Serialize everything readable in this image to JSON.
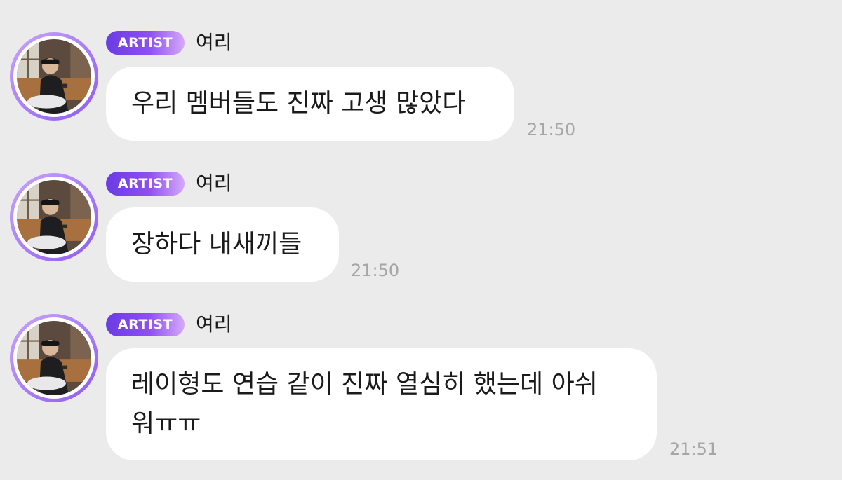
{
  "messages": [
    {
      "badge": "ARTIST",
      "sender": "여리",
      "text": "우리 멤버들도 진짜 고생 많았다",
      "time": "21:50"
    },
    {
      "badge": "ARTIST",
      "sender": "여리",
      "text": "장하다 내새끼들",
      "time": "21:50"
    },
    {
      "badge": "ARTIST",
      "sender": "여리",
      "text_line1": "레이형도 연습 같이 진짜 열심히 했는데 아쉬",
      "text_line2": "워ㅠㅠ",
      "time": "21:51"
    }
  ],
  "colors": {
    "background": "#ebebeb",
    "bubble": "#ffffff",
    "badge_start": "#6a3be4",
    "badge_end": "#d5a8fb",
    "avatar_ring": "#a478f5",
    "timestamp": "#a6a6a6"
  }
}
